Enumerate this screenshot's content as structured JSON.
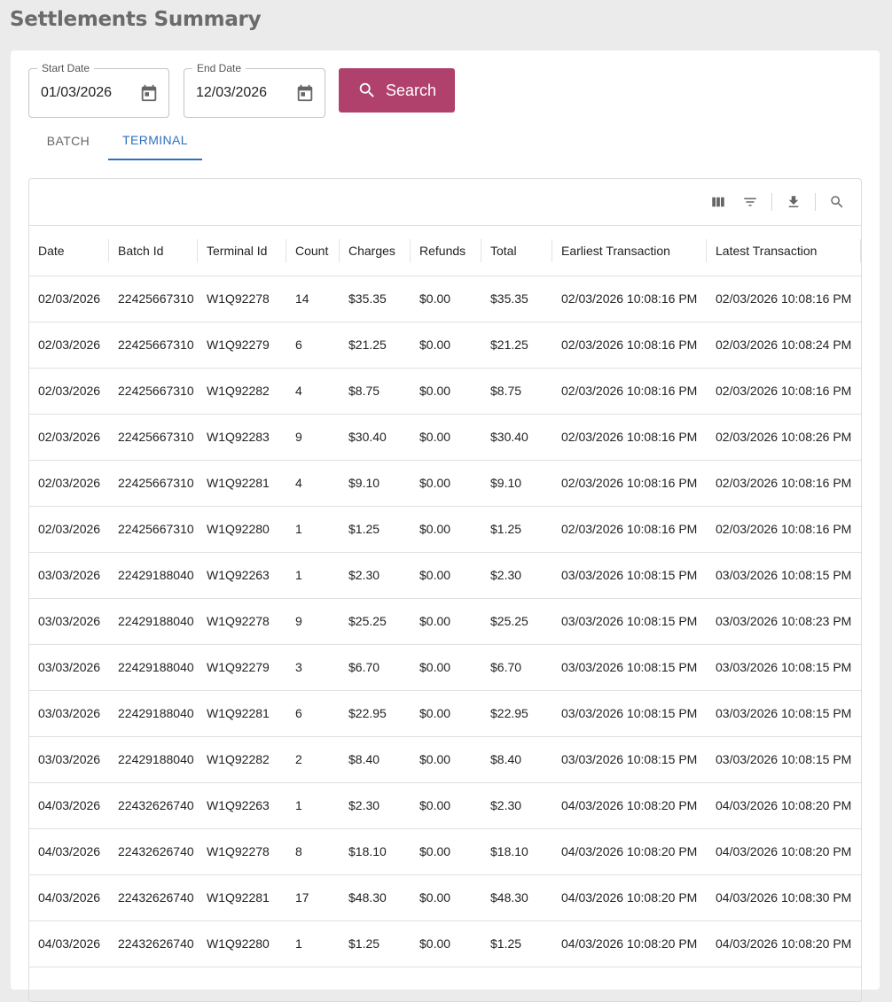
{
  "page": {
    "title": "Settlements Summary"
  },
  "filters": {
    "start_date": {
      "label": "Start Date",
      "value": "01/03/2026"
    },
    "end_date": {
      "label": "End Date",
      "value": "12/03/2026"
    },
    "search_label": "Search"
  },
  "tabs": [
    {
      "label": "BATCH",
      "active": false
    },
    {
      "label": "TERMINAL",
      "active": true
    }
  ],
  "toolbar": [
    "columns-icon",
    "filter-icon",
    "download-icon",
    "search-icon"
  ],
  "colors": {
    "accent": "#b0416d",
    "tab_active": "#2f6fbf"
  },
  "table": {
    "columns": [
      "Date",
      "Batch Id",
      "Terminal Id",
      "Count",
      "Charges",
      "Refunds",
      "Total",
      "Earliest Transaction",
      "Latest Transaction"
    ],
    "rows": [
      [
        "02/03/2026",
        "22425667310",
        "W1Q92278",
        "14",
        "$35.35",
        "$0.00",
        "$35.35",
        "02/03/2026 10:08:16 PM",
        "02/03/2026 10:08:16 PM"
      ],
      [
        "02/03/2026",
        "22425667310",
        "W1Q92279",
        "6",
        "$21.25",
        "$0.00",
        "$21.25",
        "02/03/2026 10:08:16 PM",
        "02/03/2026 10:08:24 PM"
      ],
      [
        "02/03/2026",
        "22425667310",
        "W1Q92282",
        "4",
        "$8.75",
        "$0.00",
        "$8.75",
        "02/03/2026 10:08:16 PM",
        "02/03/2026 10:08:16 PM"
      ],
      [
        "02/03/2026",
        "22425667310",
        "W1Q92283",
        "9",
        "$30.40",
        "$0.00",
        "$30.40",
        "02/03/2026 10:08:16 PM",
        "02/03/2026 10:08:26 PM"
      ],
      [
        "02/03/2026",
        "22425667310",
        "W1Q92281",
        "4",
        "$9.10",
        "$0.00",
        "$9.10",
        "02/03/2026 10:08:16 PM",
        "02/03/2026 10:08:16 PM"
      ],
      [
        "02/03/2026",
        "22425667310",
        "W1Q92280",
        "1",
        "$1.25",
        "$0.00",
        "$1.25",
        "02/03/2026 10:08:16 PM",
        "02/03/2026 10:08:16 PM"
      ],
      [
        "03/03/2026",
        "22429188040",
        "W1Q92263",
        "1",
        "$2.30",
        "$0.00",
        "$2.30",
        "03/03/2026 10:08:15 PM",
        "03/03/2026 10:08:15 PM"
      ],
      [
        "03/03/2026",
        "22429188040",
        "W1Q92278",
        "9",
        "$25.25",
        "$0.00",
        "$25.25",
        "03/03/2026 10:08:15 PM",
        "03/03/2026 10:08:23 PM"
      ],
      [
        "03/03/2026",
        "22429188040",
        "W1Q92279",
        "3",
        "$6.70",
        "$0.00",
        "$6.70",
        "03/03/2026 10:08:15 PM",
        "03/03/2026 10:08:15 PM"
      ],
      [
        "03/03/2026",
        "22429188040",
        "W1Q92281",
        "6",
        "$22.95",
        "$0.00",
        "$22.95",
        "03/03/2026 10:08:15 PM",
        "03/03/2026 10:08:15 PM"
      ],
      [
        "03/03/2026",
        "22429188040",
        "W1Q92282",
        "2",
        "$8.40",
        "$0.00",
        "$8.40",
        "03/03/2026 10:08:15 PM",
        "03/03/2026 10:08:15 PM"
      ],
      [
        "04/03/2026",
        "22432626740",
        "W1Q92263",
        "1",
        "$2.30",
        "$0.00",
        "$2.30",
        "04/03/2026 10:08:20 PM",
        "04/03/2026 10:08:20 PM"
      ],
      [
        "04/03/2026",
        "22432626740",
        "W1Q92278",
        "8",
        "$18.10",
        "$0.00",
        "$18.10",
        "04/03/2026 10:08:20 PM",
        "04/03/2026 10:08:20 PM"
      ],
      [
        "04/03/2026",
        "22432626740",
        "W1Q92281",
        "17",
        "$48.30",
        "$0.00",
        "$48.30",
        "04/03/2026 10:08:20 PM",
        "04/03/2026 10:08:30 PM"
      ],
      [
        "04/03/2026",
        "22432626740",
        "W1Q92280",
        "1",
        "$1.25",
        "$0.00",
        "$1.25",
        "04/03/2026 10:08:20 PM",
        "04/03/2026 10:08:20 PM"
      ]
    ]
  }
}
